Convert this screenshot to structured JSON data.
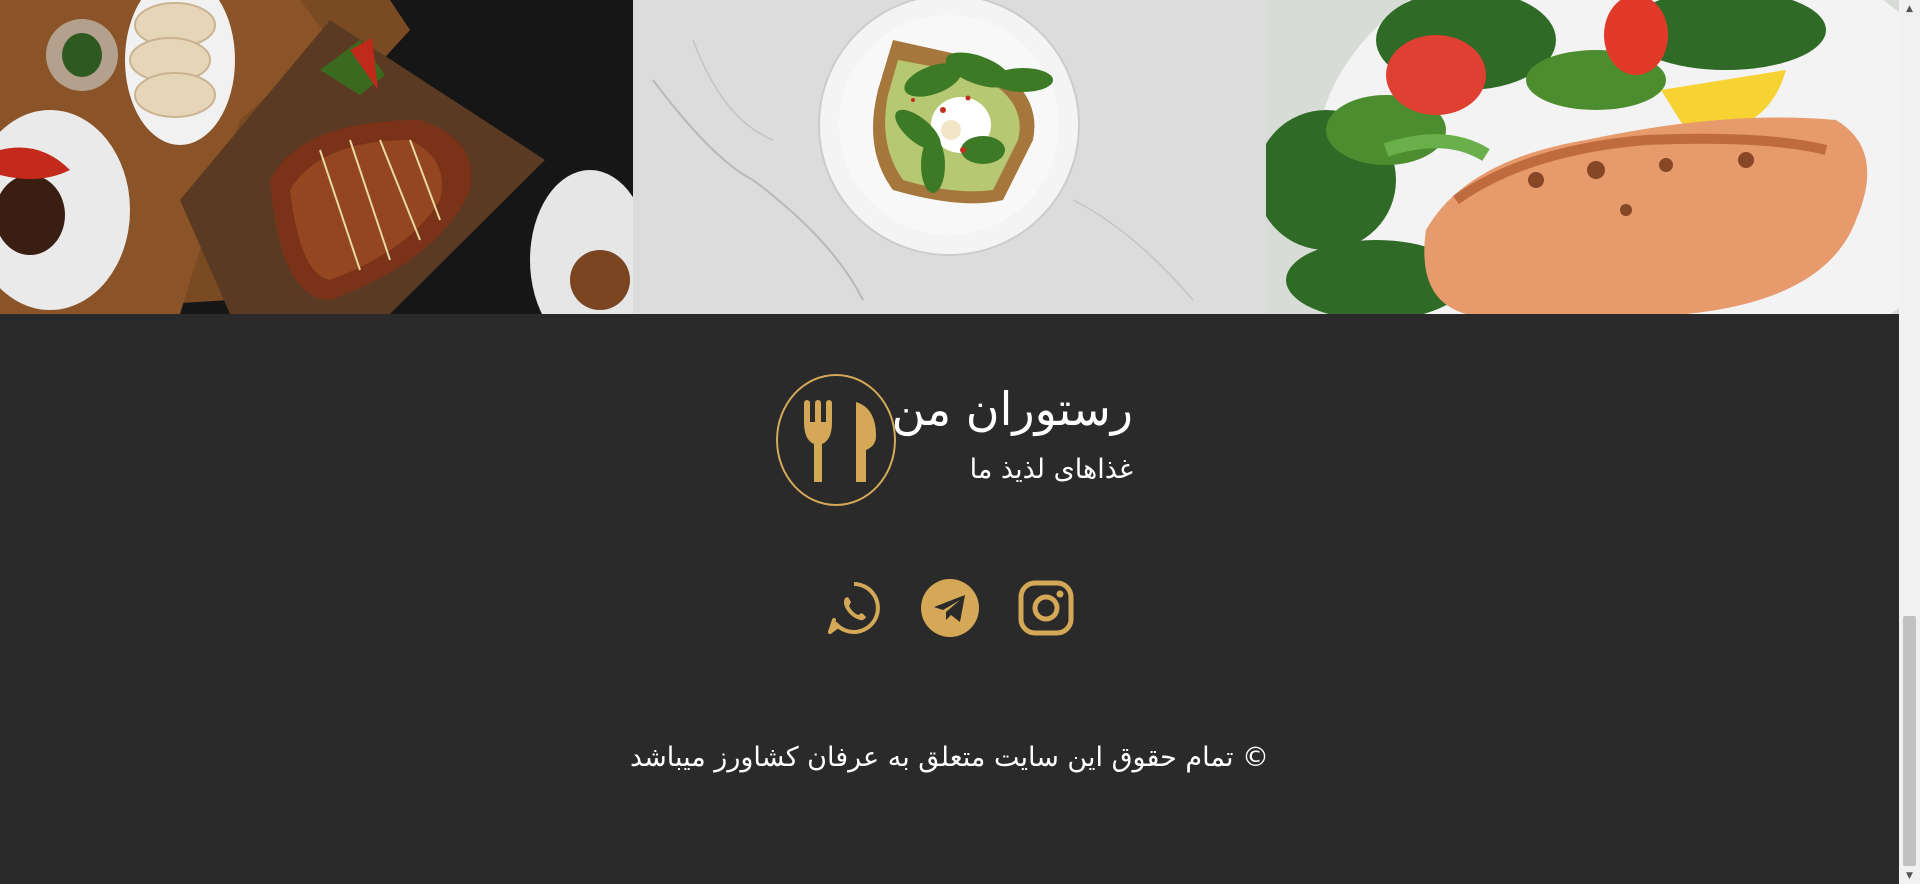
{
  "gallery": {
    "photos": [
      {
        "alt": "grilled-fish-platter"
      },
      {
        "alt": "avocado-toast-plate"
      },
      {
        "alt": "salmon-salad"
      }
    ]
  },
  "footer": {
    "brand": {
      "title": "رستوران من",
      "subtitle": "غذاهای لذیذ ما",
      "logo_icon": "fork-spoon-icon"
    },
    "socials": [
      {
        "name": "whatsapp",
        "icon": "whatsapp-icon"
      },
      {
        "name": "telegram",
        "icon": "telegram-icon"
      },
      {
        "name": "instagram",
        "icon": "instagram-icon"
      }
    ],
    "copyright": "© تمام حقوق این سایت متعلق به عرفان کشاورز میباشد"
  },
  "colors": {
    "background": "#2a2a2a",
    "accent": "#d4a857",
    "text": "#ffffff"
  }
}
